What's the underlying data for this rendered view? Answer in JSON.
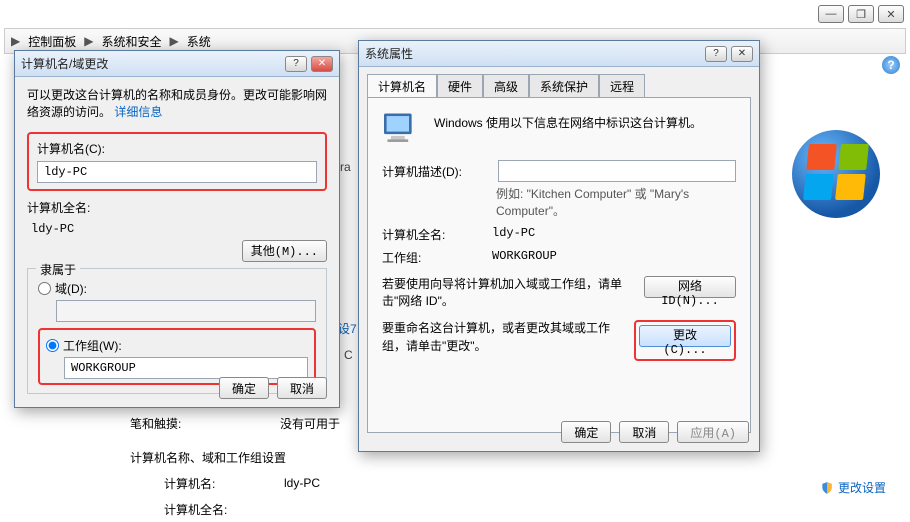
{
  "window_controls": {
    "min": "—",
    "max": "❐",
    "close": "✕"
  },
  "breadcrumb": {
    "items": [
      "控制面板",
      "系统和安全",
      "系统"
    ],
    "sep": "▶"
  },
  "logo_name": "windows-logo",
  "change_settings_link": "更改设置",
  "bg": {
    "pen_label": "笔和触摸:",
    "pen_value": "没有可用于",
    "section": "计算机名称、域和工作组设置",
    "cn_label": "计算机名:",
    "cn_value": "ldy-PC",
    "fullname_label": "计算机全名:",
    "peek1": "设7",
    "peek2": "C",
    "peek3": "ra"
  },
  "dlg_rename": {
    "title": "计算机名/域更改",
    "desc1": "可以更改这台计算机的名称和成员身份。更改可能影响网络资源的访问。",
    "desc_link": "详细信息",
    "cn_label": "计算机名(C):",
    "cn_value": "ldy-PC",
    "fullname_label": "计算机全名:",
    "fullname_value": "ldy-PC",
    "more_btn": "其他(M)...",
    "member_legend": "隶属于",
    "domain_radio": "域(D):",
    "workgroup_radio": "工作组(W):",
    "workgroup_value": "WORKGROUP",
    "ok": "确定",
    "cancel": "取消"
  },
  "dlg_sysprops": {
    "title": "系统属性",
    "tabs": [
      "计算机名",
      "硬件",
      "高级",
      "系统保护",
      "远程"
    ],
    "active_tab": 0,
    "heading": "Windows 使用以下信息在网络中标识这台计算机。",
    "desc_label": "计算机描述(D):",
    "desc_value": "",
    "desc_example": "例如: \"Kitchen Computer\" 或 \"Mary's Computer\"。",
    "fullname_label": "计算机全名:",
    "fullname_value": "ldy-PC",
    "workgroup_label": "工作组:",
    "workgroup_value": "WORKGROUP",
    "netid_text": "若要使用向导将计算机加入域或工作组，请单击\"网络 ID\"。",
    "netid_btn": "网络 ID(N)...",
    "change_text": "要重命名这台计算机，或者更改其域或工作组，请单击\"更改\"。",
    "change_btn": "更改(C)...",
    "ok": "确定",
    "cancel": "取消",
    "apply": "应用(A)"
  }
}
